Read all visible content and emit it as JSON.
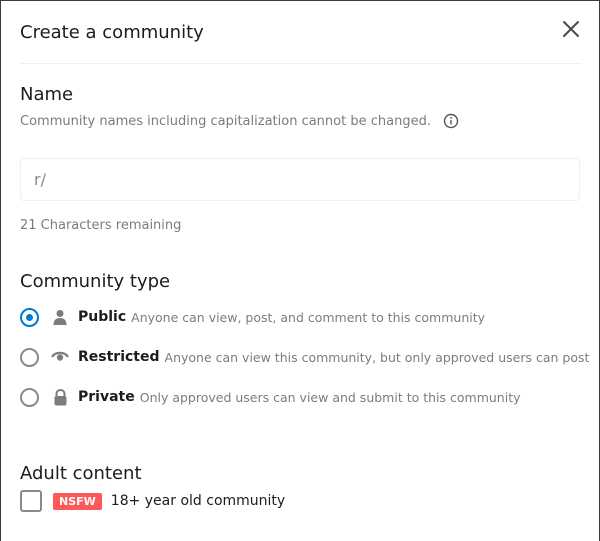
{
  "modal": {
    "title": "Create a community",
    "close_icon": "close-icon"
  },
  "name_section": {
    "title": "Name",
    "hint": "Community names including capitalization cannot be changed.",
    "info_icon": "info-icon",
    "prefix": "r/",
    "value": "",
    "chars_remaining": "21 Characters remaining"
  },
  "type_section": {
    "title": "Community type",
    "options": [
      {
        "label": "Public",
        "description": "Anyone can view, post, and comment to this community",
        "icon": "person-icon",
        "selected": true
      },
      {
        "label": "Restricted",
        "description": "Anyone can view this community, but only approved users can post",
        "icon": "eye-icon",
        "selected": false
      },
      {
        "label": "Private",
        "description": "Only approved users can view and submit to this community",
        "icon": "lock-icon",
        "selected": false
      }
    ]
  },
  "adult_section": {
    "title": "Adult content",
    "badge": "NSFW",
    "label": "18+ year old community",
    "checked": false
  },
  "colors": {
    "accent": "#0079d3",
    "nsfw": "#ff585b",
    "muted_text": "#7c7c7c"
  }
}
